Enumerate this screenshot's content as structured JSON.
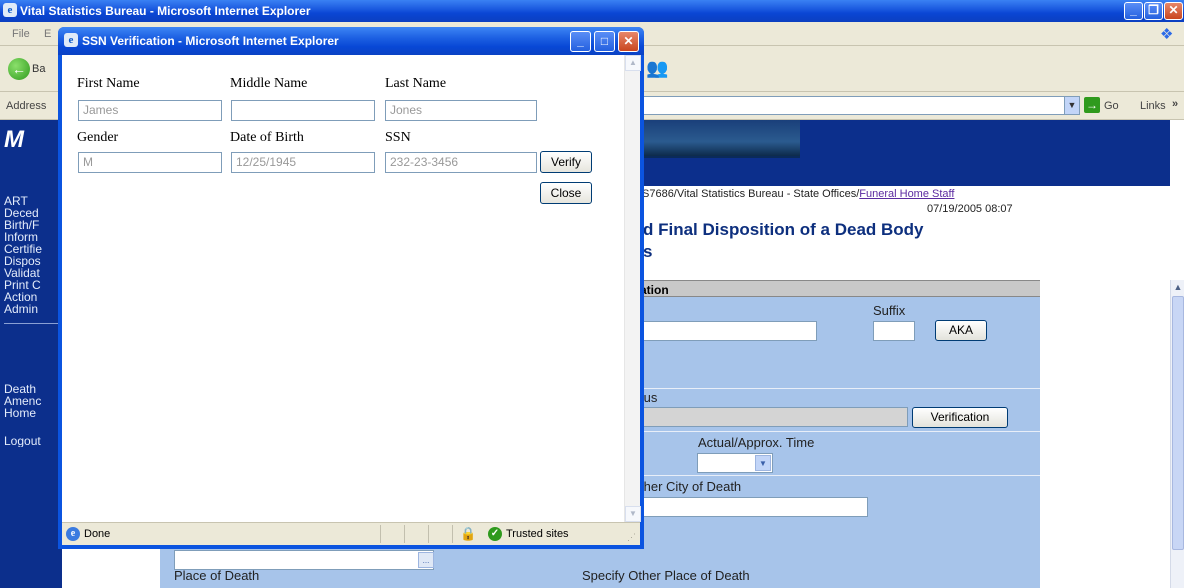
{
  "main_window": {
    "title": "Vital Statistics Bureau - Microsoft Internet Explorer",
    "menu": [
      "File",
      "E"
    ],
    "back_label": "Ba",
    "address_label": "Address",
    "go_label": "Go",
    "links_label": "Links"
  },
  "nav": {
    "logo_text": "M",
    "items": [
      "ART",
      "Deced",
      "Birth/F",
      "Inform",
      "Certifie",
      "Dispos",
      "Validat",
      "Print C",
      "Action",
      "Admin"
    ],
    "items2": [
      "Death",
      "Amenc",
      "Home"
    ],
    "logout": "Logout"
  },
  "page": {
    "breadcrumb": "S7686/Vital Statistics Bureau - State Offices/",
    "breadcrumb_link": "Funeral Home Staff",
    "timestamp": "07/19/2005 08:07",
    "title_line1": "d Final Disposition of a Dead Body",
    "title_line2": "s"
  },
  "form": {
    "section_header": "ation",
    "suffix_label": "Suffix",
    "aka_button": "AKA",
    "status_label": "tus",
    "verification_button": "Verification",
    "time_label": "Actual/Approx. Time",
    "city_label": "ther City of Death",
    "ellipsis": "...",
    "place_label": "Place of Death",
    "other_place_label": "Specify Other Place of Death"
  },
  "popup": {
    "title": "SSN Verification - Microsoft Internet Explorer",
    "first_name_label": "First Name",
    "middle_name_label": "Middle Name",
    "last_name_label": "Last Name",
    "first_name_value": "James",
    "middle_name_value": "",
    "last_name_value": "Jones",
    "gender_label": "Gender",
    "dob_label": "Date of Birth",
    "ssn_label": "SSN",
    "gender_value": "M",
    "dob_value": "12/25/1945",
    "ssn_value": "232-23-3456",
    "verify_button": "Verify",
    "close_button": "Close",
    "status_text": "Done",
    "zone_text": "Trusted sites"
  }
}
